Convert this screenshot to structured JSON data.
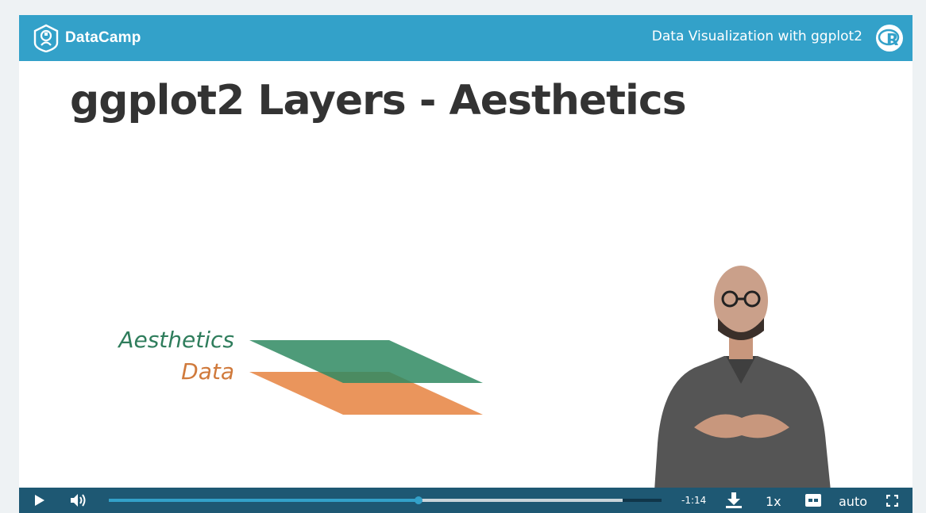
{
  "header": {
    "brand_name": "DataCamp",
    "course_title": "Data Visualization with ggplot2",
    "r_logo_icon": "r-language-logo"
  },
  "slide": {
    "title": "ggplot2 Layers - Aesthetics",
    "layers": [
      {
        "label": "Aesthetics",
        "color": "#2f8a62"
      },
      {
        "label": "Data",
        "color": "#e8894a"
      }
    ]
  },
  "controls": {
    "play_icon": "play-icon",
    "volume_icon": "volume-icon",
    "progress_played_fraction": 0.561,
    "progress_buffered_fraction": 0.93,
    "time_remaining": "-1:14",
    "download_icon": "download-icon",
    "speed": "1x",
    "captions_icon": "closed-captions-icon",
    "quality": "auto",
    "fullscreen_icon": "fullscreen-icon"
  },
  "colors": {
    "brand": "#33a1c9",
    "controls_bg": "#1e5873",
    "title_text": "#333333"
  }
}
